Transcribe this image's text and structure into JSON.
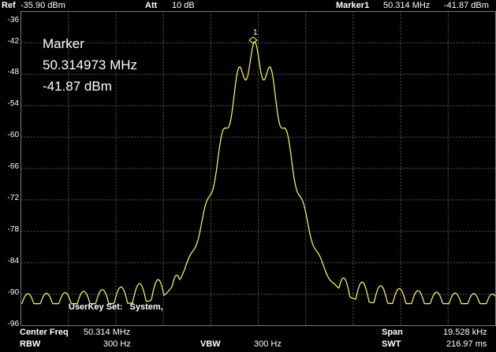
{
  "header": {
    "ref_label": "Ref",
    "ref_value": "-35.90 dBm",
    "att_label": "Att",
    "att_value": "10 dB",
    "marker_label": "Marker1",
    "marker_freq": "50.314 MHz",
    "marker_level": "-41.87 dBm"
  },
  "marker_readout": {
    "title": "Marker",
    "freq": "50.314973 MHz",
    "level": "-41.87 dBm",
    "tag": "1"
  },
  "y_axis_labels": [
    "-36",
    "-42",
    "-48",
    "-54",
    "-60",
    "-66",
    "-72",
    "-78",
    "-84",
    "-90",
    "-96"
  ],
  "userkey": {
    "label": "UserKey Set:",
    "value": "System,"
  },
  "footer": {
    "center_freq_label": "Center Freq",
    "center_freq_value": "50.314 MHz",
    "span_label": "Span",
    "span_value": "19.528 kHz",
    "rbw_label": "RBW",
    "rbw_value": "300 Hz",
    "vbw_label": "VBW",
    "vbw_value": "300 Hz",
    "swt_label": "SWT",
    "swt_value": "216.97 ms"
  },
  "colors": {
    "trace": "#ffff66",
    "grid": "#5a5a5a"
  }
}
